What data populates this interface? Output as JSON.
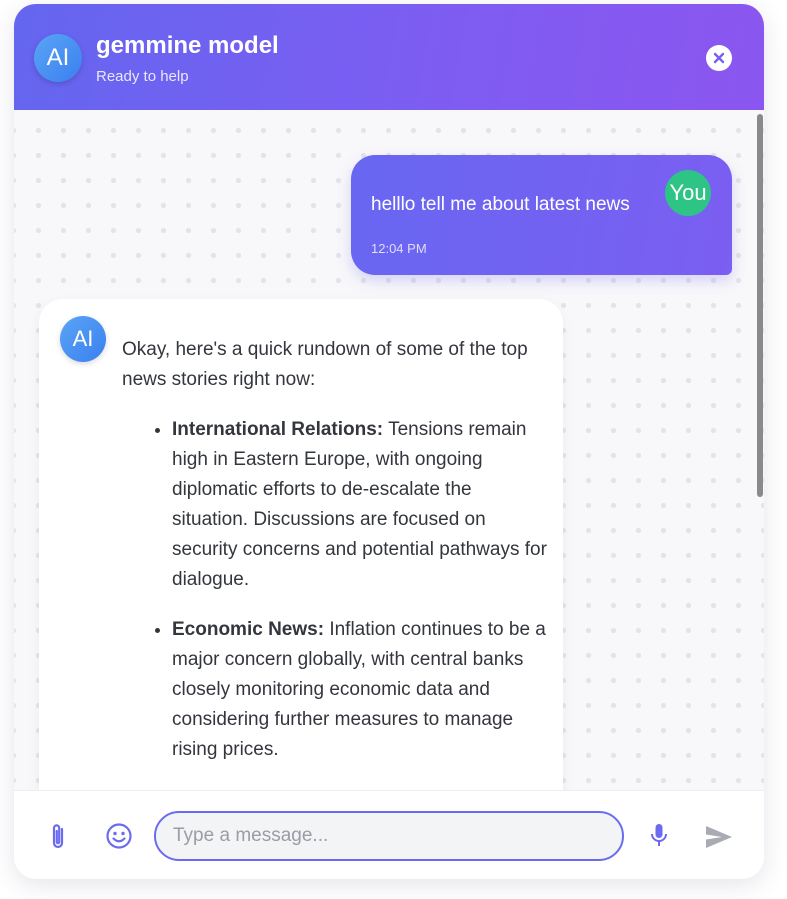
{
  "header": {
    "avatar_text": "AI",
    "title": "gemmine model",
    "status": "Ready to help",
    "close_icon": "close-icon"
  },
  "messages": {
    "user": {
      "avatar_text": "You",
      "text": "helllo tell me about latest news",
      "time": "12:04 PM"
    },
    "ai": {
      "avatar_text": "AI",
      "intro": "Okay, here's a quick rundown of some of the top news stories right now:",
      "items": [
        {
          "topic": "International Relations:",
          "text": " Tensions remain high in Eastern Europe, with ongoing diplomatic efforts to de-escalate the situation. Discussions are focused on security concerns and potential pathways for dialogue."
        },
        {
          "topic": "Economic News:",
          "text": " Inflation continues to be a major concern globally, with central banks closely monitoring economic data and considering further measures to manage rising prices."
        }
      ]
    }
  },
  "input_bar": {
    "placeholder": "Type a message...",
    "value": "",
    "icons": [
      "paperclip-icon",
      "smile-icon",
      "microphone-icon",
      "send-icon"
    ]
  },
  "colors": {
    "header_gradient_start": "#6466f0",
    "header_gradient_end": "#8b56f0",
    "user_bubble": "#6f64f1",
    "user_avatar": "#2ec485",
    "ai_avatar": "#3b7ff0",
    "icon_accent": "#6b6bf0"
  }
}
